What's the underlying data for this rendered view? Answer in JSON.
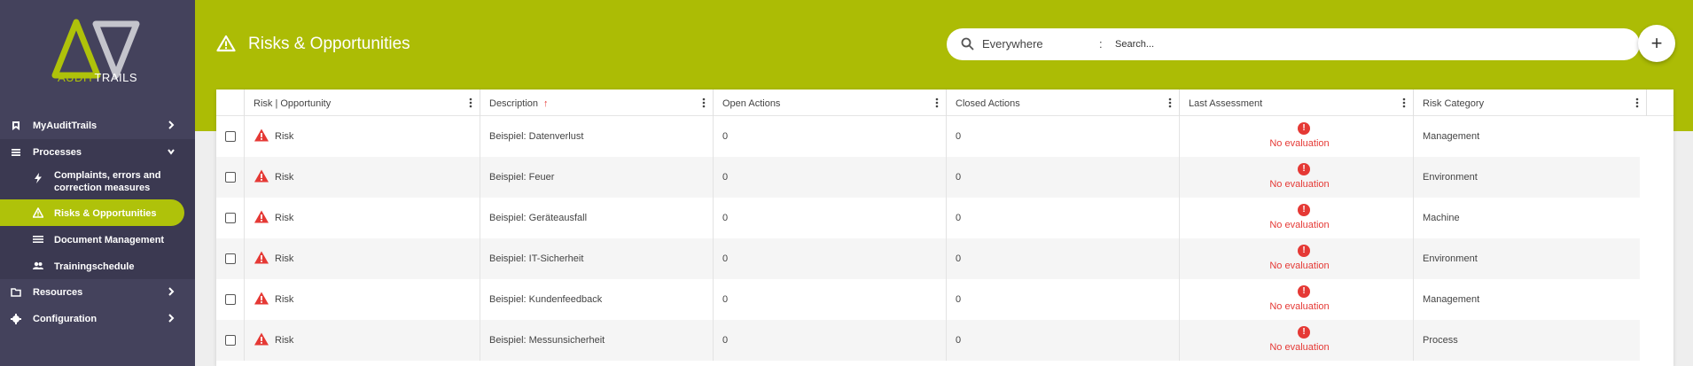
{
  "app": {
    "logo_part1": "AUDIT",
    "logo_part2": "TRAILS",
    "brand_green": "#acbc05",
    "sidebar_color": "#44425c",
    "error_color": "#e53935"
  },
  "sidebar": {
    "items": [
      {
        "label": "MyAuditTrails",
        "icon": "bookmark-icon"
      },
      {
        "label": "Processes",
        "icon": "menu-icon"
      },
      {
        "label": "Resources",
        "icon": "folder-icon"
      },
      {
        "label": "Configuration",
        "icon": "gear-icon"
      }
    ],
    "sub_items": [
      {
        "label": "Complaints, errors and",
        "label2": "correction measures",
        "icon": "bolt-icon"
      },
      {
        "label": "Risks & Opportunities",
        "icon": "warning-icon"
      },
      {
        "label": "Document Management",
        "icon": "list-icon"
      },
      {
        "label": "Trainingschedule",
        "icon": "people-icon"
      }
    ]
  },
  "header": {
    "title": "Risks & Opportunities",
    "search": {
      "scope": "Everywhere",
      "separator": ":",
      "placeholder": "Search..."
    },
    "add_label": "+"
  },
  "table": {
    "columns": [
      {
        "label": "Risk | Opportunity"
      },
      {
        "label": "Description",
        "sort": "↑"
      },
      {
        "label": "Open Actions"
      },
      {
        "label": "Closed Actions"
      },
      {
        "label": "Last Assessment"
      },
      {
        "label": "Risk Category"
      }
    ],
    "rows": [
      {
        "type": "Risk",
        "description": "Beispiel: Datenverlust",
        "open": "0",
        "closed": "0",
        "assessment": "No evaluation",
        "category": "Management"
      },
      {
        "type": "Risk",
        "description": "Beispiel: Feuer",
        "open": "0",
        "closed": "0",
        "assessment": "No evaluation",
        "category": "Environment"
      },
      {
        "type": "Risk",
        "description": "Beispiel: Geräteausfall",
        "open": "0",
        "closed": "0",
        "assessment": "No evaluation",
        "category": "Machine"
      },
      {
        "type": "Risk",
        "description": "Beispiel: IT-Sicherheit",
        "open": "0",
        "closed": "0",
        "assessment": "No evaluation",
        "category": "Environment"
      },
      {
        "type": "Risk",
        "description": "Beispiel: Kundenfeedback",
        "open": "0",
        "closed": "0",
        "assessment": "No evaluation",
        "category": "Management"
      },
      {
        "type": "Risk",
        "description": "Beispiel: Messunsicherheit",
        "open": "0",
        "closed": "0",
        "assessment": "No evaluation",
        "category": "Process"
      }
    ]
  }
}
